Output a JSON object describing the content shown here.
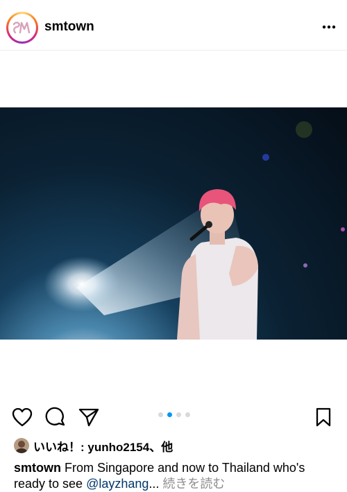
{
  "post": {
    "username": "smtown",
    "logo_text": "SM",
    "media": {
      "carousel_count": 4,
      "carousel_active_index": 1
    },
    "likes": {
      "text": "いいね！: yunho2154、他"
    },
    "caption": {
      "username": "smtown",
      "text": " From Singapore and now to Thailand who's ready to see ",
      "mention": "@layzhang",
      "ellipsis": "...",
      "more_label": " 続きを読む"
    }
  },
  "icons": {
    "more": "more-horizontal-icon",
    "like": "heart-icon",
    "comment": "comment-icon",
    "share": "send-icon",
    "save": "bookmark-icon"
  },
  "colors": {
    "accent": "#0095f6",
    "mention": "#00376b",
    "muted": "#8e8e8e"
  }
}
